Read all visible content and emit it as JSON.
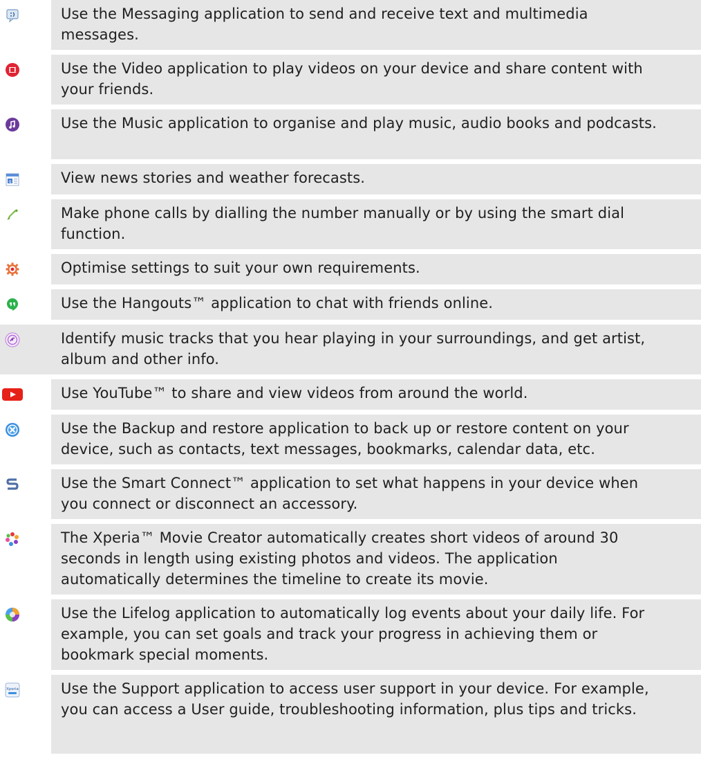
{
  "apps": [
    {
      "icon": "messaging-icon",
      "text": "Use the Messaging application to send and receive text and multimedia messages."
    },
    {
      "icon": "video-icon",
      "text": "Use the Video application to play videos on your device and share content with your friends."
    },
    {
      "icon": "music-icon",
      "text": "Use the Music application to organise and play music, audio books and podcasts."
    },
    {
      "icon": "news-weather-icon",
      "text": "View news stories and weather forecasts."
    },
    {
      "icon": "phone-icon",
      "text": "Make phone calls by dialling the number manually or by using the smart dial function."
    },
    {
      "icon": "settings-icon",
      "text": "Optimise settings to suit your own requirements."
    },
    {
      "icon": "hangouts-icon",
      "text": "Use the Hangouts™ application to chat with friends online."
    },
    {
      "icon": "trackid-icon",
      "text": "Identify music tracks that you hear playing in your surroundings, and get artist, album and other info."
    },
    {
      "icon": "youtube-icon",
      "text": "Use YouTube™ to share and view videos from around the world."
    },
    {
      "icon": "backup-restore-icon",
      "text": "Use the Backup and restore application to back up or restore content on your device, such as contacts, text messages, bookmarks, calendar data, etc."
    },
    {
      "icon": "smart-connect-icon",
      "text": "Use the Smart Connect™ application to set what happens in your device when you connect or disconnect an accessory."
    },
    {
      "icon": "movie-creator-icon",
      "text": "The Xperia™ Movie Creator automatically creates short videos of around 30 seconds in length using existing photos and videos. The application automatically determines the timeline to create its movie."
    },
    {
      "icon": "lifelog-icon",
      "text": "Use the Lifelog application to automatically log events about your daily life. For example, you can set goals and track your progress in achieving them or bookmark special moments."
    },
    {
      "icon": "support-icon",
      "text": "Use the Support application to access user support in your device. For example, you can access a User guide, troubleshooting information, plus tips and tricks."
    }
  ],
  "support_icon_label": "Xperia"
}
